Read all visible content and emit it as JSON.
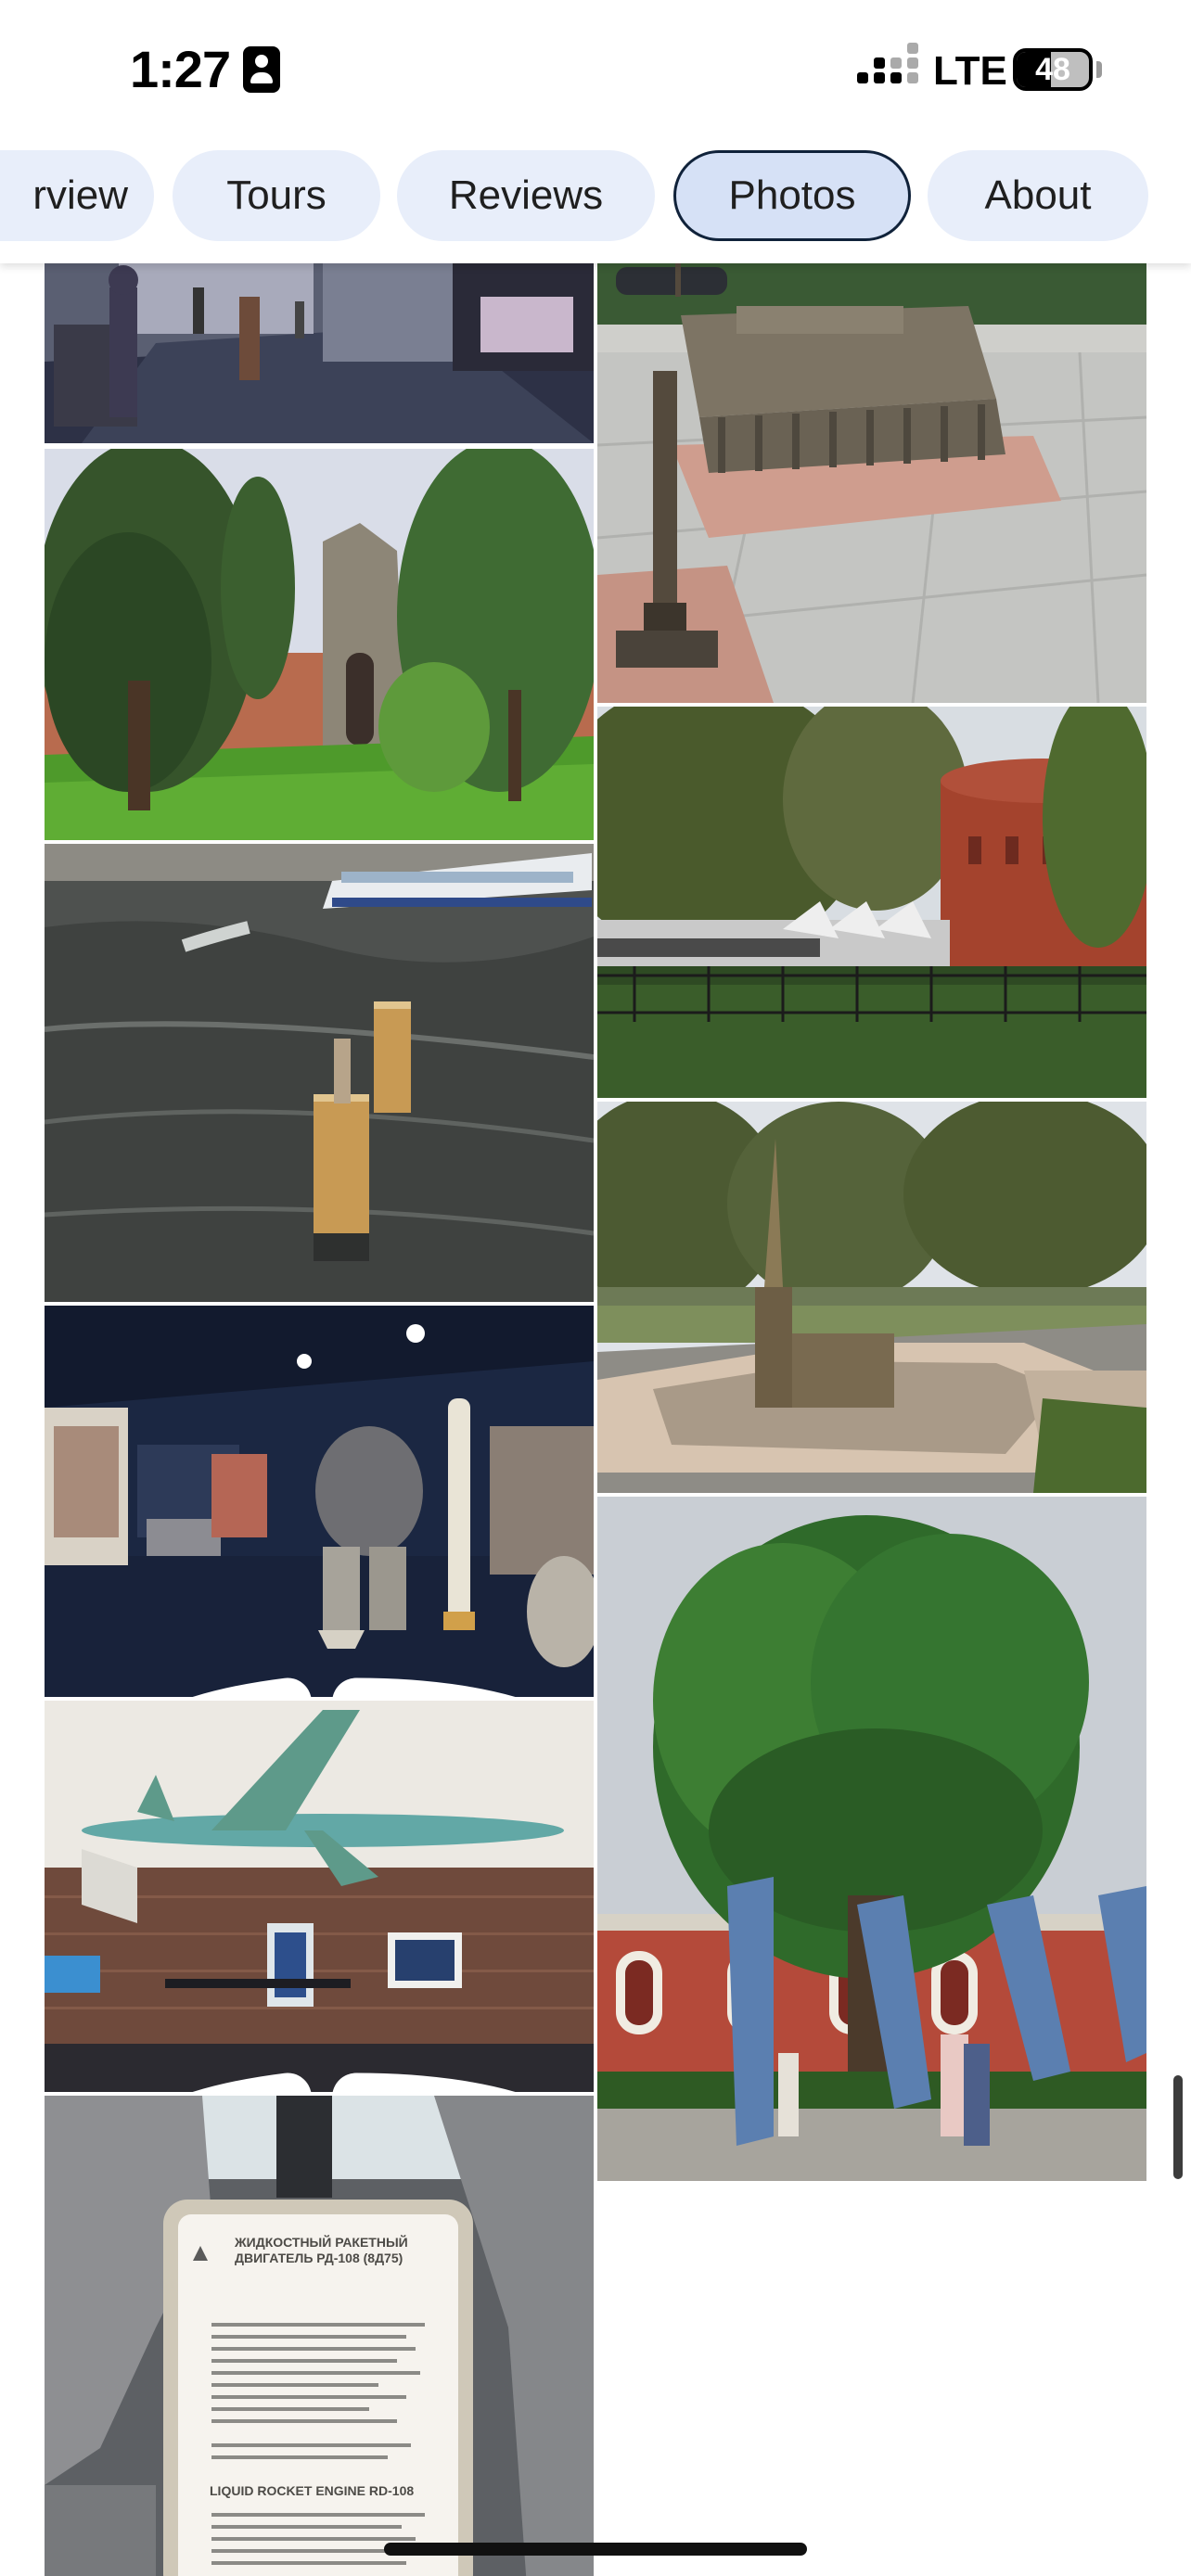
{
  "status_bar": {
    "time": "1:27",
    "network": "LTE",
    "battery_level": "48",
    "battery_fraction": 0.48
  },
  "tabs": [
    {
      "label": "Overview",
      "shown_text": "rview",
      "selected": false
    },
    {
      "label": "Tours",
      "shown_text": "Tours",
      "selected": false
    },
    {
      "label": "Reviews",
      "shown_text": "Reviews",
      "selected": false
    },
    {
      "label": "Photos",
      "shown_text": "Photos",
      "selected": true
    },
    {
      "label": "About",
      "shown_text": "About",
      "selected": false
    }
  ],
  "photos": {
    "left_column": [
      {
        "subject": "museum hall with visitors",
        "pano": false
      },
      {
        "subject": "fortress gate with trees and lawn",
        "pano": false
      },
      {
        "subject": "river with tour boat and wooden pilings",
        "pano": false
      },
      {
        "subject": "rocket engine exhibit hall",
        "pano": true
      },
      {
        "subject": "aircraft model hanging over brick wall exhibition",
        "pano": true
      },
      {
        "subject": "liquid rocket engine information plaque",
        "pano": false
      }
    ],
    "right_column": [
      {
        "subject": "bronze miniature building model with rostral column",
        "pano": false
      },
      {
        "subject": "park with rocket display and red bastion",
        "pano": false
      },
      {
        "subject": "miniature cathedral and fortress model",
        "pano": false
      },
      {
        "subject": "large oak tree with blue banners in front of red building",
        "pano": false
      }
    ]
  },
  "plaque": {
    "heading_1": "ЖИДКОСТНЫЙ РАКЕТНЫЙ ДВИГАТЕЛЬ РД-108 (8Д75)",
    "heading_2": "LIQUID ROCKET ENGINE RD-108"
  },
  "colors": {
    "tab_background": "#e8eefa",
    "tab_selected_background": "#d6e1f6",
    "tab_selected_border": "#10223a"
  }
}
